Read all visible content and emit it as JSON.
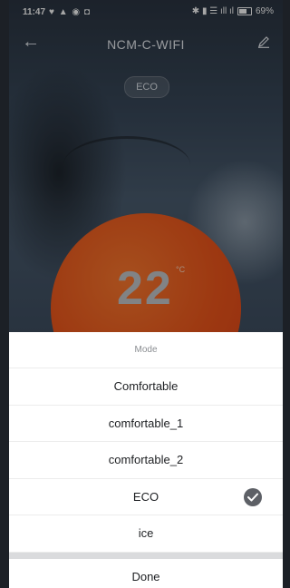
{
  "status_bar": {
    "time": "11:47",
    "left_icons": "♥ ▲ ◉ ◘",
    "right_icons": "✱ ▮ ☰ ıll ıl",
    "battery": "69%"
  },
  "header": {
    "title": "NCM-C-WIFI",
    "back_icon": "arrow-left-icon",
    "edit_icon": "pencil-icon"
  },
  "mode_badge": "ECO",
  "temperature": {
    "value": "22",
    "unit": "°C"
  },
  "sheet": {
    "title": "Mode",
    "options": [
      {
        "label": "Comfortable",
        "selected": false
      },
      {
        "label": "comfortable_1",
        "selected": false
      },
      {
        "label": "comfortable_2",
        "selected": false
      },
      {
        "label": "ECO",
        "selected": true
      },
      {
        "label": "ice",
        "selected": false
      }
    ],
    "done_label": "Done"
  },
  "colors": {
    "accent_circle": "#f1561b",
    "check_badge": "#5d6066"
  }
}
